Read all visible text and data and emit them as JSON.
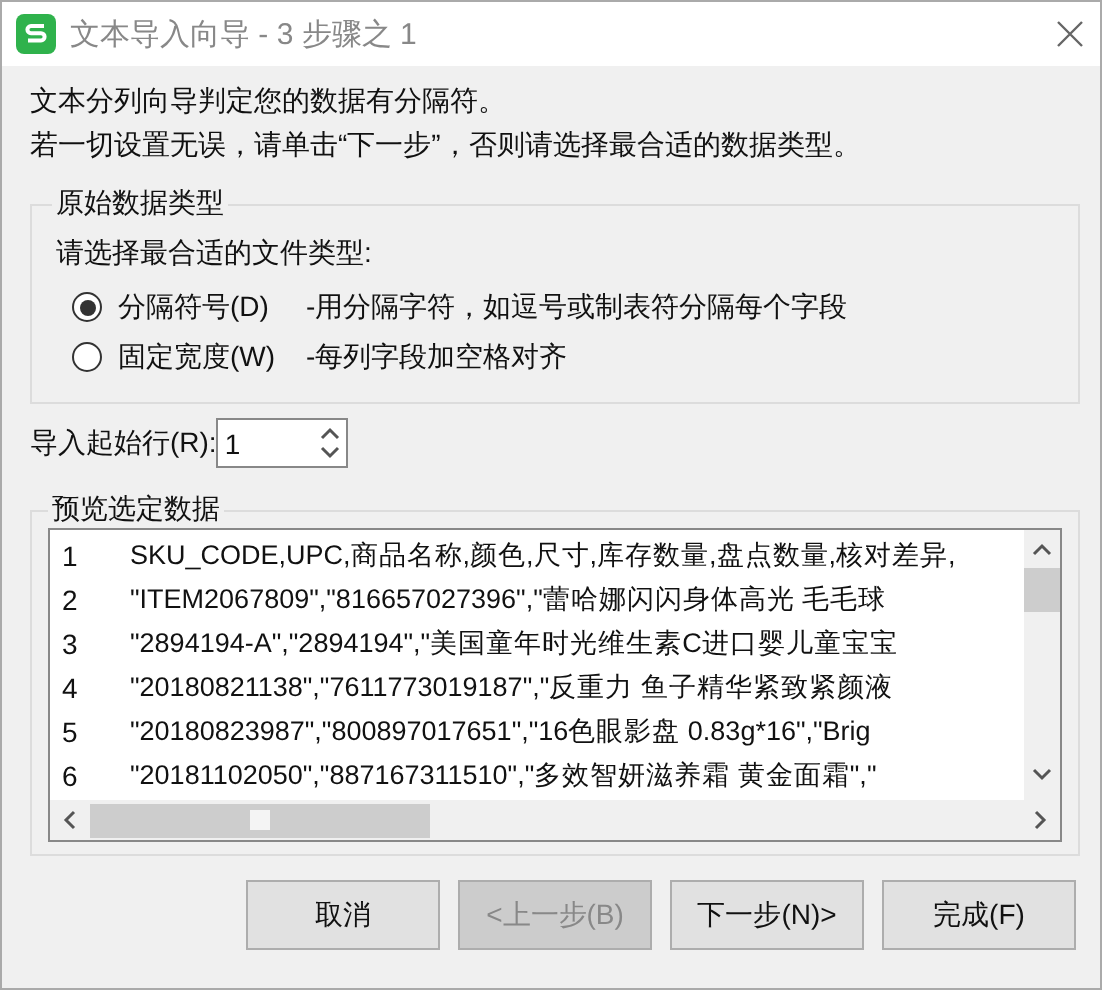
{
  "window": {
    "title": "文本导入向导 - 3 步骤之 1"
  },
  "intro": [
    "文本分列向导判定您的数据有分隔符。",
    "若一切设置无误，请单击“下一步”，否则请选择最合适的数据类型。"
  ],
  "data_type": {
    "title": "原始数据类型",
    "prompt": "请选择最合适的文件类型:",
    "options": [
      {
        "label": "分隔符号(D)",
        "description": "-用分隔字符，如逗号或制表符分隔每个字段",
        "selected": true
      },
      {
        "label": "固定宽度(W)",
        "description": "-每列字段加空格对齐",
        "selected": false
      }
    ]
  },
  "start_row": {
    "label": "导入起始行(R):",
    "value": "1"
  },
  "preview": {
    "title": "预览选定数据",
    "rows": [
      {
        "number": "1",
        "text": "SKU_CODE,UPC,商品名称,颜色,尺寸,库存数量,盘点数量,核对差异,"
      },
      {
        "number": "2",
        "text": "\"ITEM2067809\",\"816657027396\",\"蕾哈娜闪闪身体高光 毛毛球"
      },
      {
        "number": "3",
        "text": "\"2894194-A\",\"2894194\",\"美国童年时光维生素C进口婴儿童宝宝"
      },
      {
        "number": "4",
        "text": "\"20180821138\",\"7611773019187\",\"反重力 鱼子精华紧致紧颜液"
      },
      {
        "number": "5",
        "text": "\"20180823987\",\"800897017651\",\"16色眼影盘 0.83g*16\",\"Brig"
      },
      {
        "number": "6",
        "text": "\"20181102050\",\"887167311510\",\"多效智妍滋养霜  黄金面霜\",\""
      }
    ]
  },
  "buttons": [
    {
      "label": "取消",
      "disabled": false
    },
    {
      "label": "<上一步(B)",
      "disabled": true
    },
    {
      "label": "下一步(N)>",
      "disabled": false
    },
    {
      "label": "完成(F)",
      "disabled": false
    }
  ]
}
